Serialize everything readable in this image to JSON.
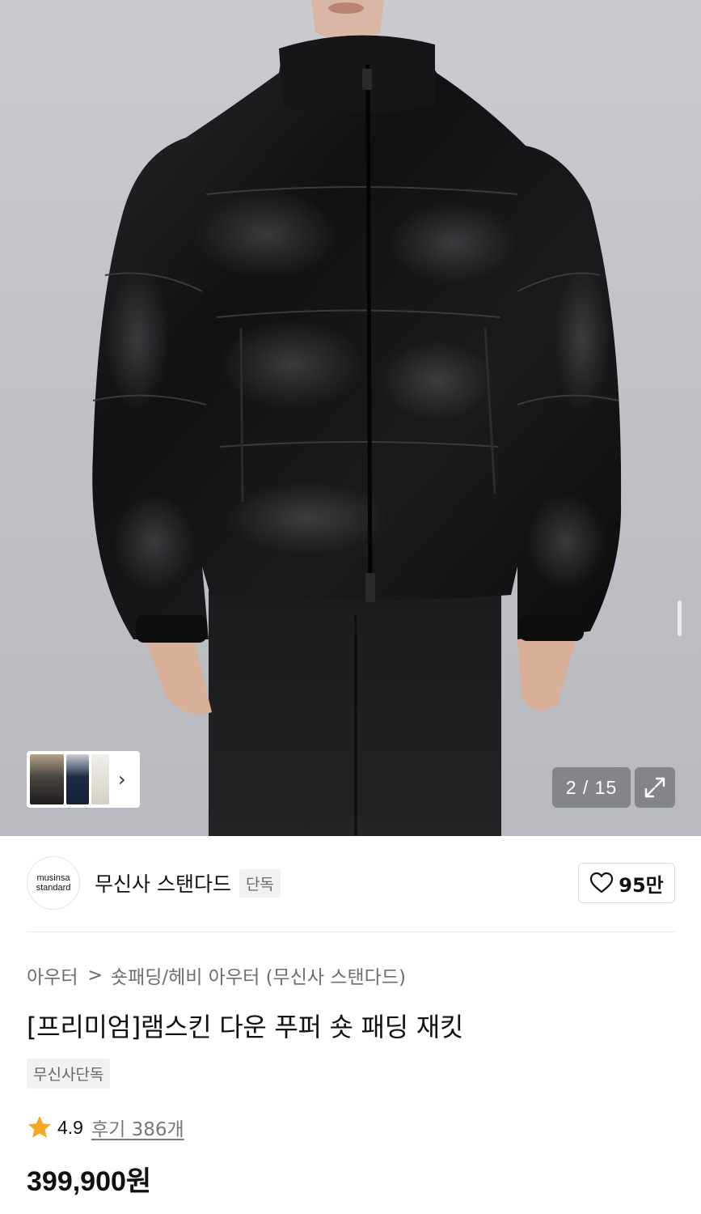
{
  "gallery": {
    "image_name": "black lambskin puffer jacket model photo",
    "counter": "2 / 15",
    "thumbnails": [
      "black-jacket-thumb",
      "navy-jacket-thumb",
      "ivory-jacket-thumb"
    ],
    "icons": {
      "next": "chevron-right-icon",
      "expand": "expand-arrows-icon"
    }
  },
  "brand": {
    "logo_line1": "musinsa",
    "logo_line2": "standard",
    "name": "무신사 스탠다드",
    "tag": "단독"
  },
  "like": {
    "icon": "heart-outline-icon",
    "count": "95만"
  },
  "breadcrumb": {
    "category": "아우터",
    "separator": ">",
    "subcategory": "숏패딩/헤비 아우터 (무신사 스탠다드)"
  },
  "product": {
    "title": "[프리미엄]램스킨 다운 푸퍼 숏 패딩 재킷",
    "badge": "무신사단독",
    "rating": "4.9",
    "review_label": "후기 386개",
    "price": "399,900",
    "currency": "원"
  },
  "colors": {
    "star": "#f5a623",
    "text": "#111111",
    "muted": "#6e6e6e"
  }
}
